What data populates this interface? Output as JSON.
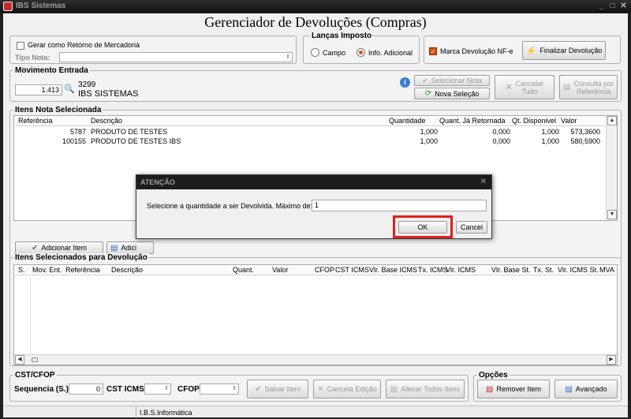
{
  "window": {
    "title": "IBS Sistemas",
    "minimize": "_",
    "maximize": "□",
    "close": "✕"
  },
  "header": {
    "title": "Gerenciador de Devoluções (Compras)"
  },
  "top": {
    "gerar_retorno_label": "Gerar como Retorno de Mercadoria",
    "tipo_nota_label": "Tipo Nota:",
    "tipo_nota_value": "",
    "lancas_imposto": {
      "title": "Lanças Imposto",
      "campo": "Campo",
      "info_adicional": "Info. Adicional",
      "selected": "info_adicional"
    },
    "marca_devolucao_label": "Marca Devolução NF-e",
    "finalizar_label": "Finalizar Devolução"
  },
  "movimento": {
    "title": "Movimento Entrada",
    "value": "1.413",
    "code": "3299",
    "name": "IBS SISTEMAS",
    "selecionar_nota": "Selecionar Nota",
    "nova_selecao": "Nova Seleção",
    "cancelar_tudo": "Cancelar\nTudo",
    "consulta_referencia": "Consulta por\nReferência"
  },
  "itens_nota": {
    "title": "Itens Nota Selecionada",
    "columns": [
      "Referência",
      "Descrição",
      "Quantidade",
      "Quant. Já Retornada",
      "Qt. Disponivel",
      "Valor"
    ],
    "rows": [
      {
        "ref": "5787",
        "desc": "PRODUTO DE TESTES",
        "qtd": "1,000",
        "ret": "0,000",
        "disp": "1,000",
        "valor": "573,3600"
      },
      {
        "ref": "100155",
        "desc": "PRODUTO DE TESTES IBS",
        "qtd": "1,000",
        "ret": "0,000",
        "disp": "1,000",
        "valor": "580,5900"
      }
    ],
    "adicionar_item": "Adicionar Item",
    "adicionar_all_partial": "Adici"
  },
  "itens_devolucao": {
    "title": "Itens Selecionados para Devolução",
    "columns": [
      "S.",
      "Mov. Ent.",
      "Referência",
      "Descrição",
      "Quant.",
      "Valor",
      "CFOP",
      "CST ICMS",
      "Vlr. Base ICMS",
      "Tx. ICMS",
      "Vlr. ICMS",
      "Vlr. Base St.",
      "Tx. St.",
      "Vlr. ICMS St.",
      "MVA"
    ]
  },
  "cst_cfop": {
    "title": "CST/CFOP",
    "sequencia_label": "Sequencia (S.)",
    "sequencia_value": "0",
    "cst_label": "CST ICMS",
    "cst_value": "",
    "cfop_label": "CFOP",
    "cfop_value": "",
    "salvar": "Salvar Item",
    "cancela": "Cancela Edição",
    "alterar": "Alterar Todos Itens"
  },
  "opcoes": {
    "title": "Opções",
    "remover": "Remover Item",
    "avancado": "Avançado"
  },
  "status": {
    "text": "I.B.S.Informática"
  },
  "dialog": {
    "title": "ATENÇÃO",
    "message": "Selecione a quantidade a ser Devolvida. Máximo de: 1",
    "input_value": "1",
    "ok": "OK",
    "cancel": "Cancel"
  },
  "colors": {
    "accent": "#d4520f",
    "highlight": "#e0201c",
    "titlebar": "#1c1c1c"
  }
}
